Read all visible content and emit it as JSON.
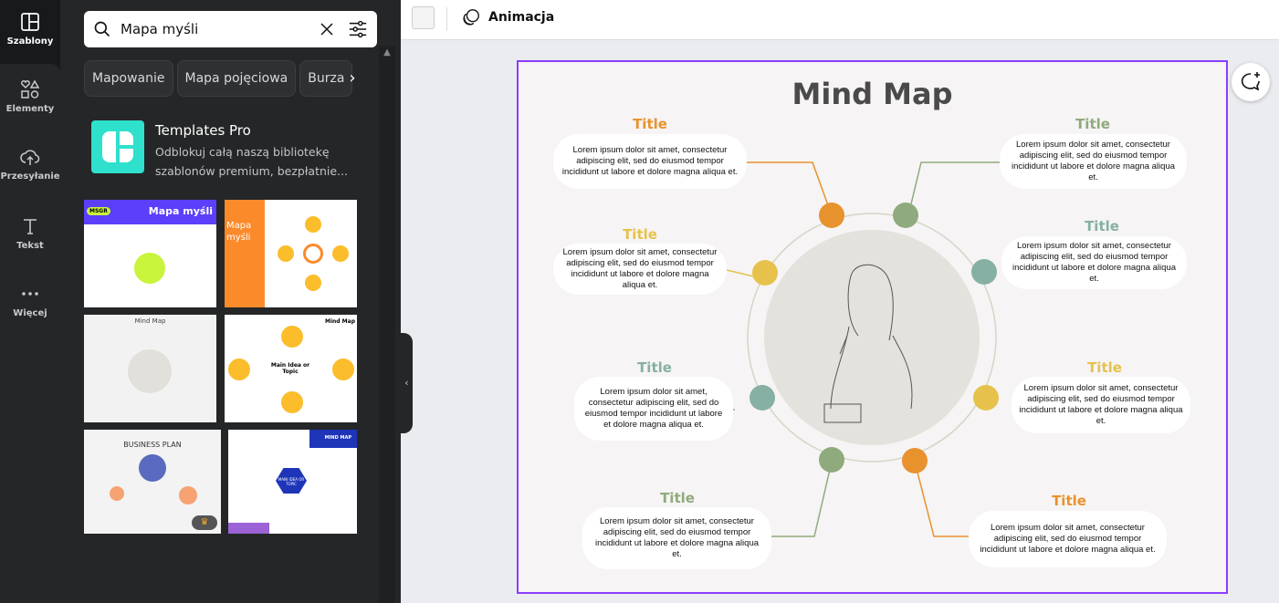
{
  "rail": [
    {
      "label": "Szablony",
      "icon": "templates-icon"
    },
    {
      "label": "Elementy",
      "icon": "elements-icon"
    },
    {
      "label": "Przesyłanie",
      "icon": "upload-icon"
    },
    {
      "label": "Tekst",
      "icon": "text-icon"
    },
    {
      "label": "Więcej",
      "icon": "more-icon"
    }
  ],
  "search": {
    "value": "Mapa myśli"
  },
  "chips": [
    "Mapowanie",
    "Mapa pojęciowa",
    "Burza"
  ],
  "pro": {
    "title": "Templates Pro",
    "desc": "Odblokuj całą naszą bibliotekę szablonów premium, bezpłatnie..."
  },
  "thumbs": {
    "t1": "Mapa myśli",
    "t1badge": "MSGR",
    "t2": "Mapa myśli",
    "t3": "Mind Map",
    "t4a": "Main Idea or Topic",
    "t4b": "Mind Map",
    "t5": "BUSINESS PLAN",
    "t6a": "MIND MAP",
    "t6b": "MAIN IDEA OR TOPIC"
  },
  "toolbar": {
    "animate": "Animacja"
  },
  "slide": {
    "title": "Mind Map",
    "nodes": [
      {
        "title": "Title",
        "text": "Lorem ipsum dolor sit amet, consectetur adipiscing elit, sed do eiusmod tempor incididunt ut labore et dolore magna aliqua et.",
        "color": "#e8922e"
      },
      {
        "title": "Title",
        "text": "Lorem ipsum dolor sit amet, consectetur adipiscing elit, sed do eiusmod tempor incididunt ut labore et dolore magna aliqua et.",
        "color": "#8fab7d"
      },
      {
        "title": "Title",
        "text": "Lorem ipsum dolor sit amet, consectetur adipiscing elit, sed do eiusmod tempor incididunt ut labore et dolore magna aliqua et.",
        "color": "#e6c24c"
      },
      {
        "title": "Title",
        "text": "Lorem ipsum dolor sit amet, consectetur adipiscing elit, sed do eiusmod tempor incididunt ut labore et dolore magna aliqua et.",
        "color": "#86b0a3"
      },
      {
        "title": "Title",
        "text": "Lorem ipsum dolor sit amet, consectetur adipiscing elit, sed do eiusmod tempor incididunt ut labore et dolore magna aliqua et.",
        "color": "#86b0a3"
      },
      {
        "title": "Title",
        "text": "Lorem ipsum dolor sit amet, consectetur adipiscing elit, sed do eiusmod tempor incididunt ut labore et dolore magna aliqua et.",
        "color": "#e6c24c"
      },
      {
        "title": "Title",
        "text": "Lorem ipsum dolor sit amet, consectetur adipiscing elit, sed do eiusmod tempor incididunt ut labore et dolore magna aliqua et.",
        "color": "#8fab7d"
      },
      {
        "title": "Title",
        "text": "Lorem ipsum dolor sit amet, consectetur adipiscing elit, sed do eiusmod tempor incididunt ut labore et dolore magna aliqua et.",
        "color": "#e8922e"
      }
    ]
  },
  "colors": {
    "accent": "#8b3dff",
    "pro": "#2fe0cd"
  }
}
